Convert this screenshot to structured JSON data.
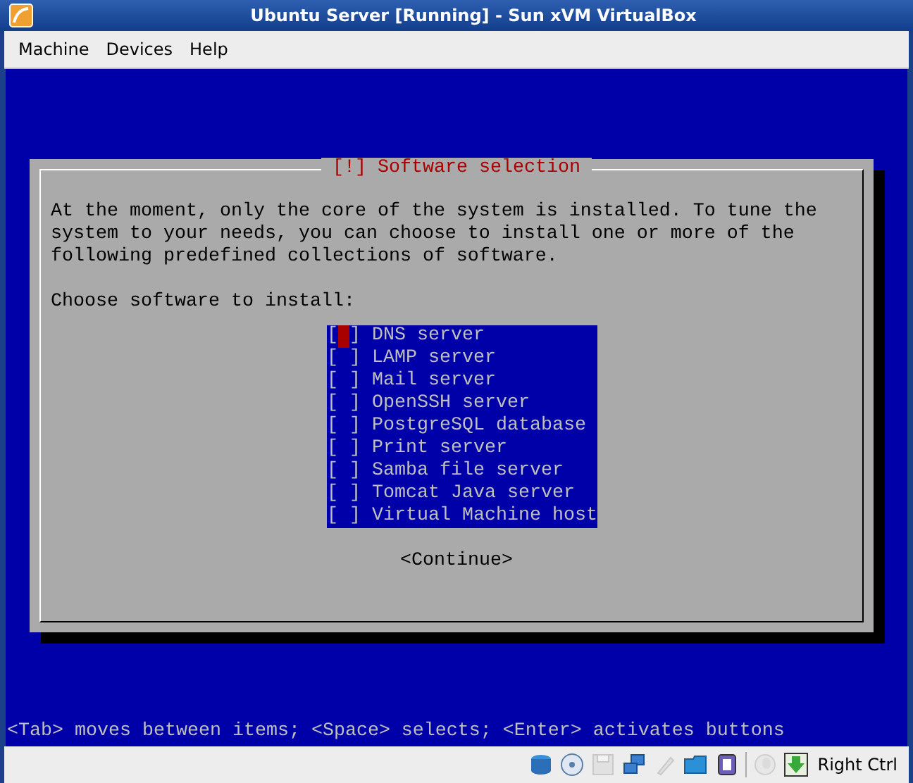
{
  "window": {
    "title": "Ubuntu Server [Running] - Sun xVM VirtualBox"
  },
  "menu": [
    "Machine",
    "Devices",
    "Help"
  ],
  "dialog": {
    "title": "[!] Software selection",
    "message": "At the moment, only the core of the system is installed. To tune the system to your needs, you can choose to install one or more of the following predefined collections of software.",
    "prompt": "Choose software to install:",
    "items": [
      {
        "box": "[ ]",
        "label": "DNS server",
        "checked": false,
        "selected": true
      },
      {
        "box": "[ ]",
        "label": "LAMP server",
        "checked": false,
        "selected": false
      },
      {
        "box": "[ ]",
        "label": "Mail server",
        "checked": false,
        "selected": false
      },
      {
        "box": "[ ]",
        "label": "OpenSSH server",
        "checked": false,
        "selected": false
      },
      {
        "box": "[ ]",
        "label": "PostgreSQL database",
        "checked": false,
        "selected": false
      },
      {
        "box": "[ ]",
        "label": "Print server",
        "checked": false,
        "selected": false
      },
      {
        "box": "[ ]",
        "label": "Samba file server",
        "checked": false,
        "selected": false
      },
      {
        "box": "[ ]",
        "label": "Tomcat Java server",
        "checked": false,
        "selected": false
      },
      {
        "box": "[ ]",
        "label": "Virtual Machine host",
        "checked": false,
        "selected": false
      }
    ],
    "button": "<Continue>"
  },
  "hint": "<Tab> moves between items; <Space> selects; <Enter> activates buttons",
  "status_bar": {
    "indicators": [
      {
        "kind": "disk",
        "disabled": false
      },
      {
        "kind": "cd",
        "disabled": false
      },
      {
        "kind": "floppy",
        "disabled": true
      },
      {
        "kind": "network",
        "disabled": false
      },
      {
        "kind": "usb",
        "disabled": true
      },
      {
        "kind": "folder",
        "disabled": false
      },
      {
        "kind": "vtx",
        "disabled": false
      },
      {
        "kind": "separator"
      },
      {
        "kind": "mouse",
        "disabled": true
      },
      {
        "kind": "hostkey",
        "disabled": false
      }
    ],
    "host_key": "Right Ctrl"
  }
}
